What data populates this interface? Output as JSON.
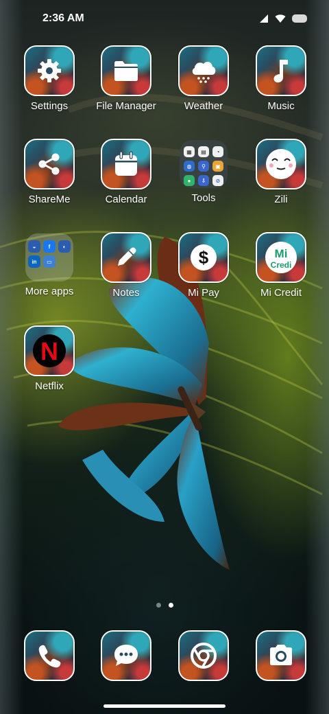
{
  "status_bar": {
    "time": "2:36 AM"
  },
  "apps": [
    {
      "key": "settings",
      "label": "Settings",
      "icon": "gear-icon"
    },
    {
      "key": "file-manager",
      "label": "File Manager",
      "icon": "folder-icon"
    },
    {
      "key": "weather",
      "label": "Weather",
      "icon": "cloud-rain-icon"
    },
    {
      "key": "music",
      "label": "Music",
      "icon": "music-note-icon"
    },
    {
      "key": "shareme",
      "label": "ShareMe",
      "icon": "share-icon"
    },
    {
      "key": "calendar",
      "label": "Calendar",
      "icon": "calendar-icon"
    },
    {
      "key": "tools",
      "label": "Tools",
      "icon": "tools-folder-icon"
    },
    {
      "key": "zili",
      "label": "Zili",
      "icon": "zili-face-icon"
    },
    {
      "key": "more-apps",
      "label": "More apps",
      "icon": "more-apps-folder-icon"
    },
    {
      "key": "notes",
      "label": "Notes",
      "icon": "pencil-icon"
    },
    {
      "key": "mi-pay",
      "label": "Mi Pay",
      "icon": "dollar-icon"
    },
    {
      "key": "mi-credit",
      "label": "Mi Credit",
      "icon": "mi-credit-icon"
    },
    {
      "key": "netflix",
      "label": "Netflix",
      "icon": "netflix-icon"
    }
  ],
  "mi_credit_logo": {
    "line1": "Mi",
    "line2": "Credi"
  },
  "netflix_logo": "N",
  "dock": [
    {
      "key": "phone",
      "icon": "phone-icon"
    },
    {
      "key": "messages",
      "icon": "message-icon"
    },
    {
      "key": "chrome",
      "icon": "chrome-icon"
    },
    {
      "key": "camera",
      "icon": "camera-icon"
    }
  ],
  "page_indicator": {
    "pages": 2,
    "current": 2
  },
  "colors": {
    "icon_border": "#ffffff",
    "wallpaper_teal": "#2fa7b8",
    "wallpaper_orange": "#c45322",
    "netflix_red": "#e50914",
    "mi_credit_green": "#1a9e6a"
  }
}
